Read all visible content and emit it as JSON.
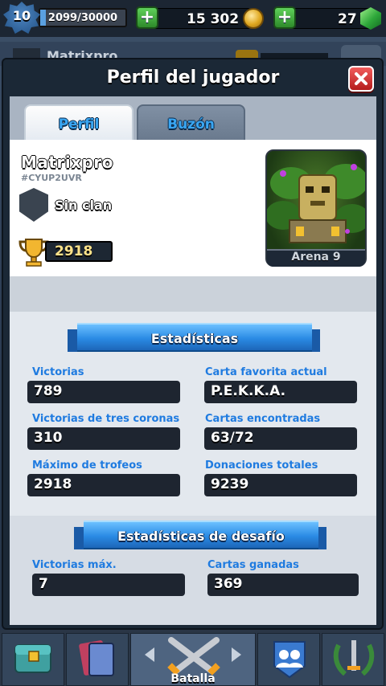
{
  "topbar": {
    "level": "10",
    "xp": "2099/30000",
    "xp_progress": 0.07,
    "gold": "15 302",
    "gems": "27"
  },
  "behind": {
    "name": "Matrixpro"
  },
  "modal": {
    "title": "Perfil del jugador",
    "tabs": [
      {
        "label": "Perfil",
        "active": true
      },
      {
        "label": "Buzón",
        "active": false
      }
    ]
  },
  "profile": {
    "name": "Matrixpro",
    "tag": "#CYUP2UVR",
    "clan": "Sin clan",
    "trophies": "2918",
    "arena": "Arena 9"
  },
  "stats": {
    "title": "Estadísticas",
    "items": [
      {
        "label": "Victorias",
        "value": "789"
      },
      {
        "label": "Carta favorita actual",
        "value": "P.E.K.K.A."
      },
      {
        "label": "Victorias de tres coronas",
        "value": "310"
      },
      {
        "label": "Cartas encontradas",
        "value": "63/72"
      },
      {
        "label": "Máximo de trofeos",
        "value": "2918"
      },
      {
        "label": "Donaciones totales",
        "value": "9239"
      }
    ]
  },
  "challenge": {
    "title": "Estadísticas de desafío",
    "items": [
      {
        "label": "Victorias máx.",
        "value": "7"
      },
      {
        "label": "Cartas ganadas",
        "value": "369"
      }
    ]
  },
  "nav": {
    "battle_label": "Batalla"
  },
  "colors": {
    "accent_blue": "#1f7be0",
    "tab_text": "#3aa6f2",
    "close_red": "#d83030",
    "trophy_gold": "#ffe28a"
  }
}
